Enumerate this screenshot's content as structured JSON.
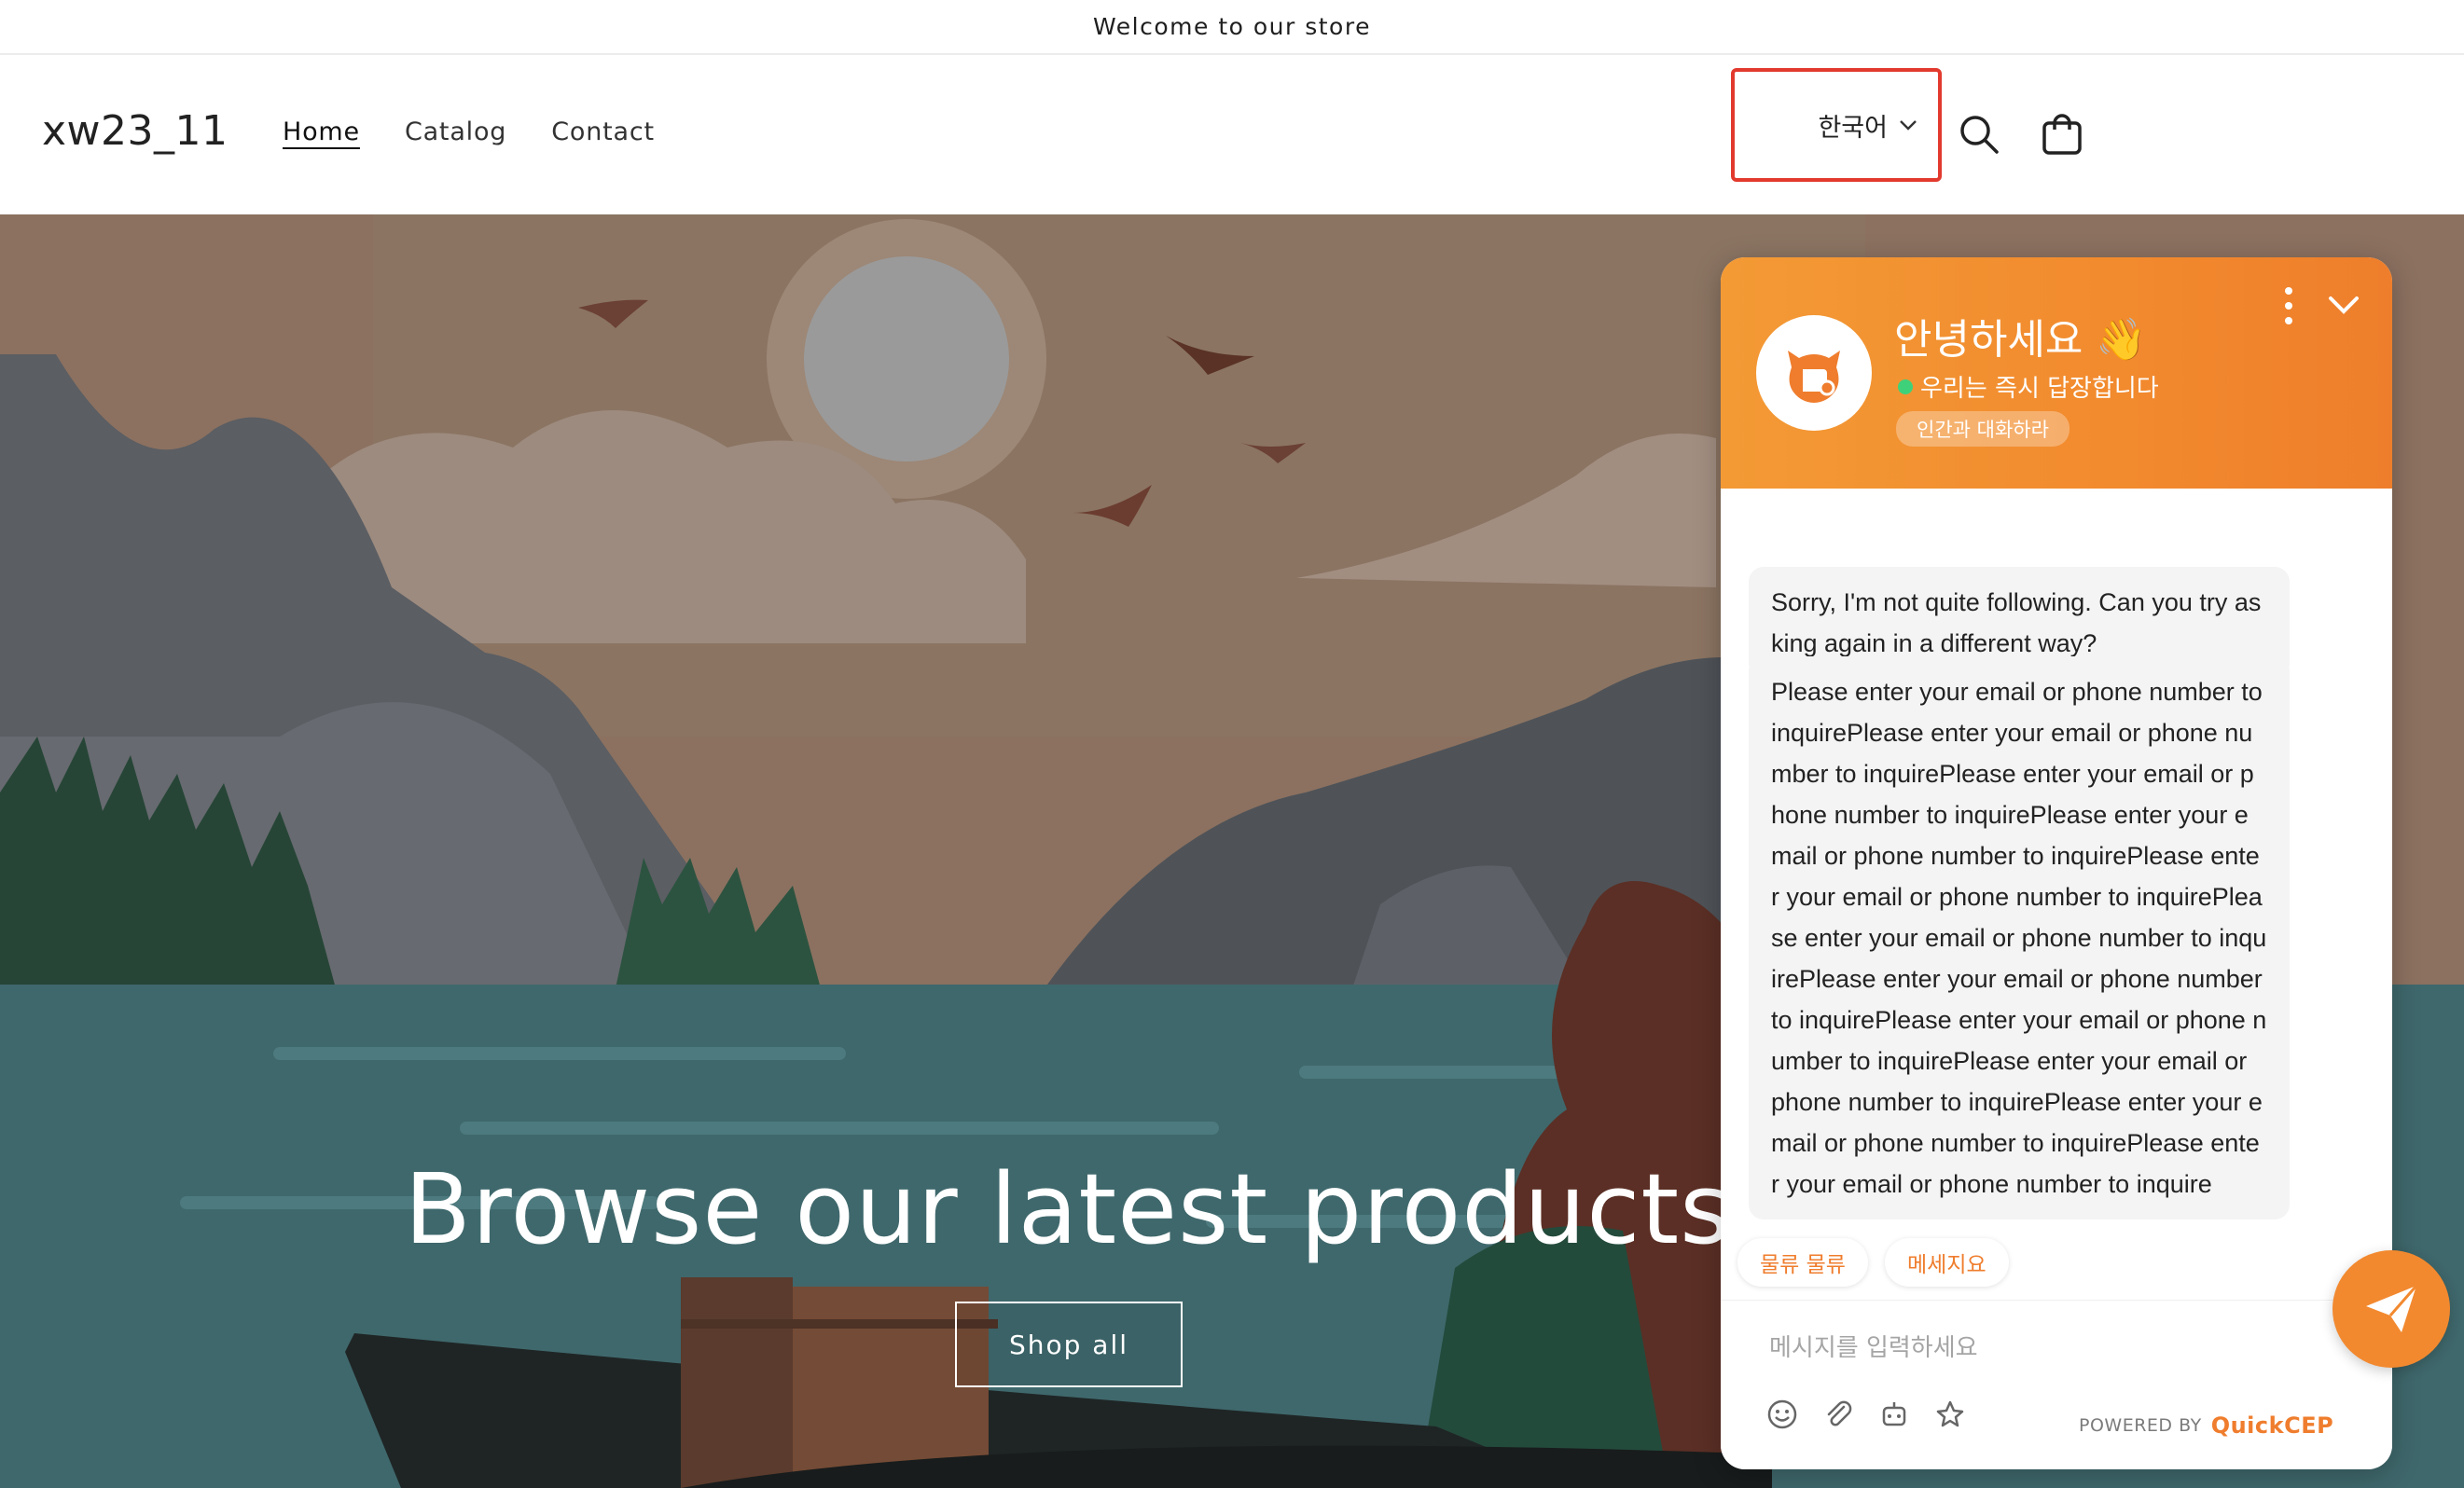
{
  "announcement": "Welcome to our store",
  "header": {
    "logo": "xw23_11",
    "nav": [
      "Home",
      "Catalog",
      "Contact"
    ],
    "language": "한국어"
  },
  "hero": {
    "title": "Browse our latest products",
    "button": "Shop all"
  },
  "chat": {
    "greeting": "안녕하세요",
    "greeting_emoji": "👋",
    "status": "우리는 즉시 답장합니다",
    "human_button": "인간과 대화하라",
    "messages": [
      "Sorry, I'm not quite following. Can you try asking again in a different way?",
      "Please enter your email or phone number to inquirePlease enter your email or phone number to inquirePlease enter your email or phone number to inquirePlease enter your email or phone number to inquirePlease enter your email or phone number to inquirePlease enter your email or phone number to inquirePlease enter your email or phone number to inquirePlease enter your email or phone number to inquirePlease enter your email or phone number to inquirePlease enter your email or phone number to inquirePlease enter your email or phone number to inquire"
    ],
    "quick_replies": [
      "물류 물류",
      "메세지요"
    ],
    "input_placeholder": "메시지를 입력하세요",
    "powered_by": "POWERED BY",
    "brand": "QuickCEP"
  },
  "colors": {
    "accent": "#f28a2e",
    "highlight_border": "#e23a2e",
    "online": "#3fd17a"
  }
}
